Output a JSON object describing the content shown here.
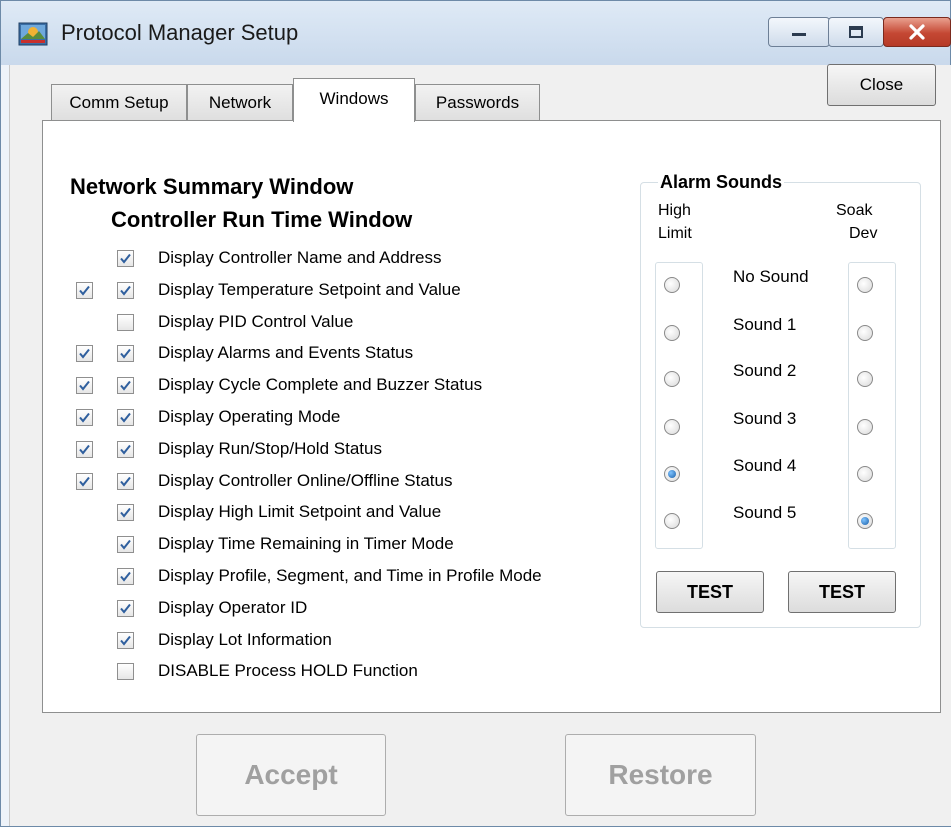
{
  "window": {
    "title": "Protocol Manager Setup",
    "icon": "protocol-manager-app-icon",
    "controls": [
      "minimize-icon",
      "maximize-icon",
      "close-icon"
    ]
  },
  "close_button": "Close",
  "tabs": [
    {
      "label": "Comm Setup",
      "active": false
    },
    {
      "label": "Network",
      "active": false
    },
    {
      "label": "Windows",
      "active": true
    },
    {
      "label": "Passwords",
      "active": false
    }
  ],
  "headers": {
    "network_summary": "Network Summary Window",
    "controller_run_time": "Controller Run Time Window"
  },
  "options": [
    {
      "label": "Display Controller Name and Address",
      "network_summary": null,
      "controller_run_time": true
    },
    {
      "label": "Display Temperature Setpoint and Value",
      "network_summary": true,
      "controller_run_time": true
    },
    {
      "label": "Display PID Control Value",
      "network_summary": null,
      "controller_run_time": false
    },
    {
      "label": "Display Alarms and Events Status",
      "network_summary": true,
      "controller_run_time": true
    },
    {
      "label": "Display Cycle Complete and Buzzer Status",
      "network_summary": true,
      "controller_run_time": true
    },
    {
      "label": "Display Operating Mode",
      "network_summary": true,
      "controller_run_time": true
    },
    {
      "label": "Display Run/Stop/Hold Status",
      "network_summary": true,
      "controller_run_time": true
    },
    {
      "label": "Display Controller Online/Offline Status",
      "network_summary": true,
      "controller_run_time": true
    },
    {
      "label": "Display High Limit Setpoint and Value",
      "network_summary": null,
      "controller_run_time": true
    },
    {
      "label": "Display Time Remaining in Timer Mode",
      "network_summary": null,
      "controller_run_time": true
    },
    {
      "label": "Display Profile, Segment, and Time in Profile Mode",
      "network_summary": null,
      "controller_run_time": true
    },
    {
      "label": "Display Operator ID",
      "network_summary": null,
      "controller_run_time": true
    },
    {
      "label": "Display Lot Information",
      "network_summary": null,
      "controller_run_time": true
    },
    {
      "label": "DISABLE Process HOLD Function",
      "network_summary": null,
      "controller_run_time": false
    }
  ],
  "alarm_sounds": {
    "title": "Alarm Sounds",
    "high_limit_label_1": "High",
    "high_limit_label_2": "Limit",
    "soak_dev_label_1": "Soak",
    "soak_dev_label_2": "Dev",
    "sounds": [
      "No Sound",
      "Sound 1",
      "Sound 2",
      "Sound 3",
      "Sound 4",
      "Sound 5"
    ],
    "high_limit_selected": "Sound 4",
    "soak_dev_selected": "Sound 5",
    "test_label": "TEST"
  },
  "buttons": {
    "accept": "Accept",
    "restore": "Restore"
  },
  "colors": {
    "checkmark": "#2f5f9e",
    "radio_selected": "#1b5fa8",
    "close_control": "#c44733"
  }
}
